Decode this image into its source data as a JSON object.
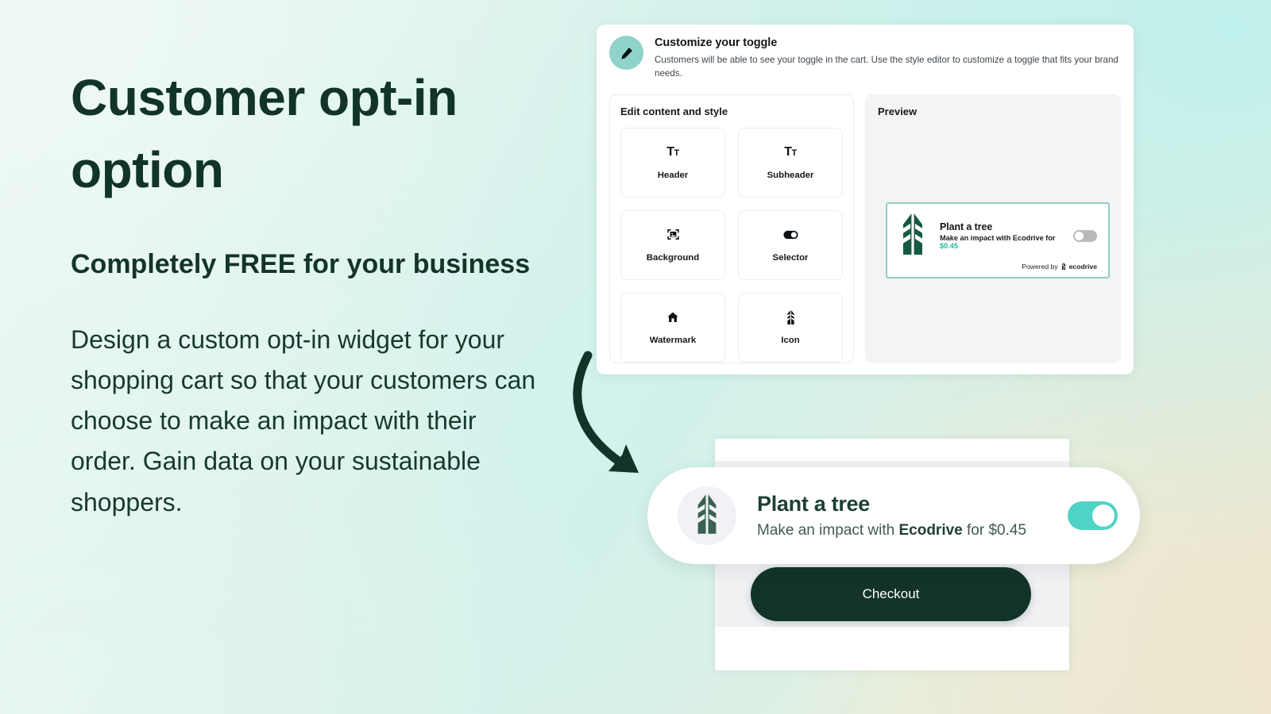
{
  "hero": {
    "headline": "Customer opt-in option",
    "subheadline": "Completely FREE for your business",
    "body": "Design a custom opt-in widget for your shopping cart so that your customers can choose to make an impact with their order. Gain data on your sustainable shoppers."
  },
  "admin_panel": {
    "title": "Customize your toggle",
    "description": "Customers will be able to see your toggle in the cart. Use the style editor to customize a toggle that fits your brand needs.",
    "avatar_icon": "pencil-icon",
    "edit_card": {
      "title": "Edit content and style",
      "tiles": [
        {
          "label": "Header",
          "icon": "text-size-icon"
        },
        {
          "label": "Subheader",
          "icon": "text-size-small-icon"
        },
        {
          "label": "Background",
          "icon": "image-frame-icon"
        },
        {
          "label": "Selector",
          "icon": "toggle-icon"
        },
        {
          "label": "Watermark",
          "icon": "home-icon"
        },
        {
          "label": "Icon",
          "icon": "tree-icon"
        }
      ]
    },
    "preview": {
      "title": "Preview",
      "widget": {
        "title": "Plant a tree",
        "subtitle_prefix": "Make an impact with Ecodrive for ",
        "price": "$0.45",
        "powered_by_label": "Powered by",
        "brand": "ecodrive",
        "toggle_state": "off"
      }
    }
  },
  "cart_mock": {
    "widget": {
      "title": "Plant a tree",
      "subtitle_before": "Make an impact with ",
      "subtitle_brand": "Ecodrive",
      "subtitle_after": " for $0.45",
      "toggle_state": "on",
      "icon": "tree-icon"
    },
    "checkout_label": "Checkout"
  },
  "colors": {
    "dark_green": "#133329",
    "teal_accent": "#4ed4c4",
    "preview_border": "#8fcec4",
    "price_teal": "#1db8a2",
    "avatar_teal": "#8fd3ca"
  }
}
